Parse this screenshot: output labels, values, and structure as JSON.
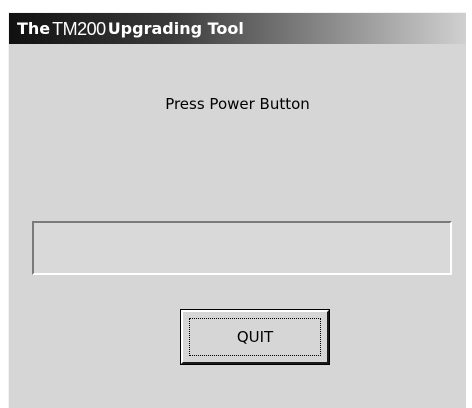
{
  "window": {
    "title_prefix": "The",
    "title_model": "TM200",
    "title_suffix": "Upgrading Tool"
  },
  "main": {
    "prompt": "Press Power Button",
    "progress": {
      "value_percent": 0
    },
    "quit_label": "QUIT"
  },
  "colors": {
    "dialog_background": "#d6d6d6",
    "titlebar_start": "#101010",
    "titlebar_end": "#d0d0d0"
  }
}
